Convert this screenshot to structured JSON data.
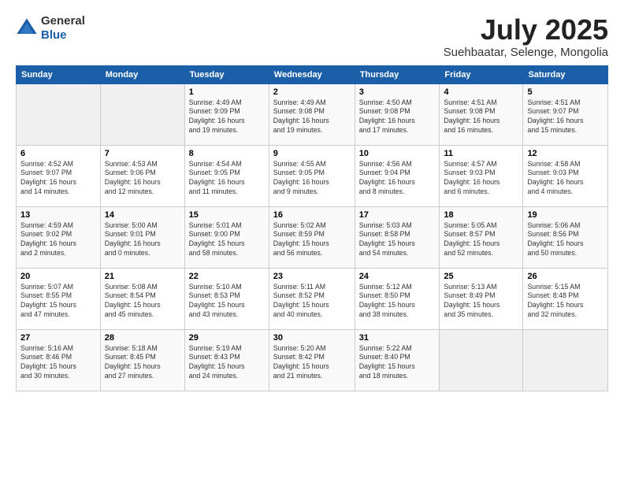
{
  "logo": {
    "general": "General",
    "blue": "Blue"
  },
  "title": "July 2025",
  "subtitle": "Suehbaatar, Selenge, Mongolia",
  "days_of_week": [
    "Sunday",
    "Monday",
    "Tuesday",
    "Wednesday",
    "Thursday",
    "Friday",
    "Saturday"
  ],
  "weeks": [
    [
      {
        "day": "",
        "info": ""
      },
      {
        "day": "",
        "info": ""
      },
      {
        "day": "1",
        "info": "Sunrise: 4:49 AM\nSunset: 9:09 PM\nDaylight: 16 hours\nand 19 minutes."
      },
      {
        "day": "2",
        "info": "Sunrise: 4:49 AM\nSunset: 9:08 PM\nDaylight: 16 hours\nand 19 minutes."
      },
      {
        "day": "3",
        "info": "Sunrise: 4:50 AM\nSunset: 9:08 PM\nDaylight: 16 hours\nand 17 minutes."
      },
      {
        "day": "4",
        "info": "Sunrise: 4:51 AM\nSunset: 9:08 PM\nDaylight: 16 hours\nand 16 minutes."
      },
      {
        "day": "5",
        "info": "Sunrise: 4:51 AM\nSunset: 9:07 PM\nDaylight: 16 hours\nand 15 minutes."
      }
    ],
    [
      {
        "day": "6",
        "info": "Sunrise: 4:52 AM\nSunset: 9:07 PM\nDaylight: 16 hours\nand 14 minutes."
      },
      {
        "day": "7",
        "info": "Sunrise: 4:53 AM\nSunset: 9:06 PM\nDaylight: 16 hours\nand 12 minutes."
      },
      {
        "day": "8",
        "info": "Sunrise: 4:54 AM\nSunset: 9:05 PM\nDaylight: 16 hours\nand 11 minutes."
      },
      {
        "day": "9",
        "info": "Sunrise: 4:55 AM\nSunset: 9:05 PM\nDaylight: 16 hours\nand 9 minutes."
      },
      {
        "day": "10",
        "info": "Sunrise: 4:56 AM\nSunset: 9:04 PM\nDaylight: 16 hours\nand 8 minutes."
      },
      {
        "day": "11",
        "info": "Sunrise: 4:57 AM\nSunset: 9:03 PM\nDaylight: 16 hours\nand 6 minutes."
      },
      {
        "day": "12",
        "info": "Sunrise: 4:58 AM\nSunset: 9:03 PM\nDaylight: 16 hours\nand 4 minutes."
      }
    ],
    [
      {
        "day": "13",
        "info": "Sunrise: 4:59 AM\nSunset: 9:02 PM\nDaylight: 16 hours\nand 2 minutes."
      },
      {
        "day": "14",
        "info": "Sunrise: 5:00 AM\nSunset: 9:01 PM\nDaylight: 16 hours\nand 0 minutes."
      },
      {
        "day": "15",
        "info": "Sunrise: 5:01 AM\nSunset: 9:00 PM\nDaylight: 15 hours\nand 58 minutes."
      },
      {
        "day": "16",
        "info": "Sunrise: 5:02 AM\nSunset: 8:59 PM\nDaylight: 15 hours\nand 56 minutes."
      },
      {
        "day": "17",
        "info": "Sunrise: 5:03 AM\nSunset: 8:58 PM\nDaylight: 15 hours\nand 54 minutes."
      },
      {
        "day": "18",
        "info": "Sunrise: 5:05 AM\nSunset: 8:57 PM\nDaylight: 15 hours\nand 52 minutes."
      },
      {
        "day": "19",
        "info": "Sunrise: 5:06 AM\nSunset: 8:56 PM\nDaylight: 15 hours\nand 50 minutes."
      }
    ],
    [
      {
        "day": "20",
        "info": "Sunrise: 5:07 AM\nSunset: 8:55 PM\nDaylight: 15 hours\nand 47 minutes."
      },
      {
        "day": "21",
        "info": "Sunrise: 5:08 AM\nSunset: 8:54 PM\nDaylight: 15 hours\nand 45 minutes."
      },
      {
        "day": "22",
        "info": "Sunrise: 5:10 AM\nSunset: 8:53 PM\nDaylight: 15 hours\nand 43 minutes."
      },
      {
        "day": "23",
        "info": "Sunrise: 5:11 AM\nSunset: 8:52 PM\nDaylight: 15 hours\nand 40 minutes."
      },
      {
        "day": "24",
        "info": "Sunrise: 5:12 AM\nSunset: 8:50 PM\nDaylight: 15 hours\nand 38 minutes."
      },
      {
        "day": "25",
        "info": "Sunrise: 5:13 AM\nSunset: 8:49 PM\nDaylight: 15 hours\nand 35 minutes."
      },
      {
        "day": "26",
        "info": "Sunrise: 5:15 AM\nSunset: 8:48 PM\nDaylight: 15 hours\nand 32 minutes."
      }
    ],
    [
      {
        "day": "27",
        "info": "Sunrise: 5:16 AM\nSunset: 8:46 PM\nDaylight: 15 hours\nand 30 minutes."
      },
      {
        "day": "28",
        "info": "Sunrise: 5:18 AM\nSunset: 8:45 PM\nDaylight: 15 hours\nand 27 minutes."
      },
      {
        "day": "29",
        "info": "Sunrise: 5:19 AM\nSunset: 8:43 PM\nDaylight: 15 hours\nand 24 minutes."
      },
      {
        "day": "30",
        "info": "Sunrise: 5:20 AM\nSunset: 8:42 PM\nDaylight: 15 hours\nand 21 minutes."
      },
      {
        "day": "31",
        "info": "Sunrise: 5:22 AM\nSunset: 8:40 PM\nDaylight: 15 hours\nand 18 minutes."
      },
      {
        "day": "",
        "info": ""
      },
      {
        "day": "",
        "info": ""
      }
    ]
  ]
}
